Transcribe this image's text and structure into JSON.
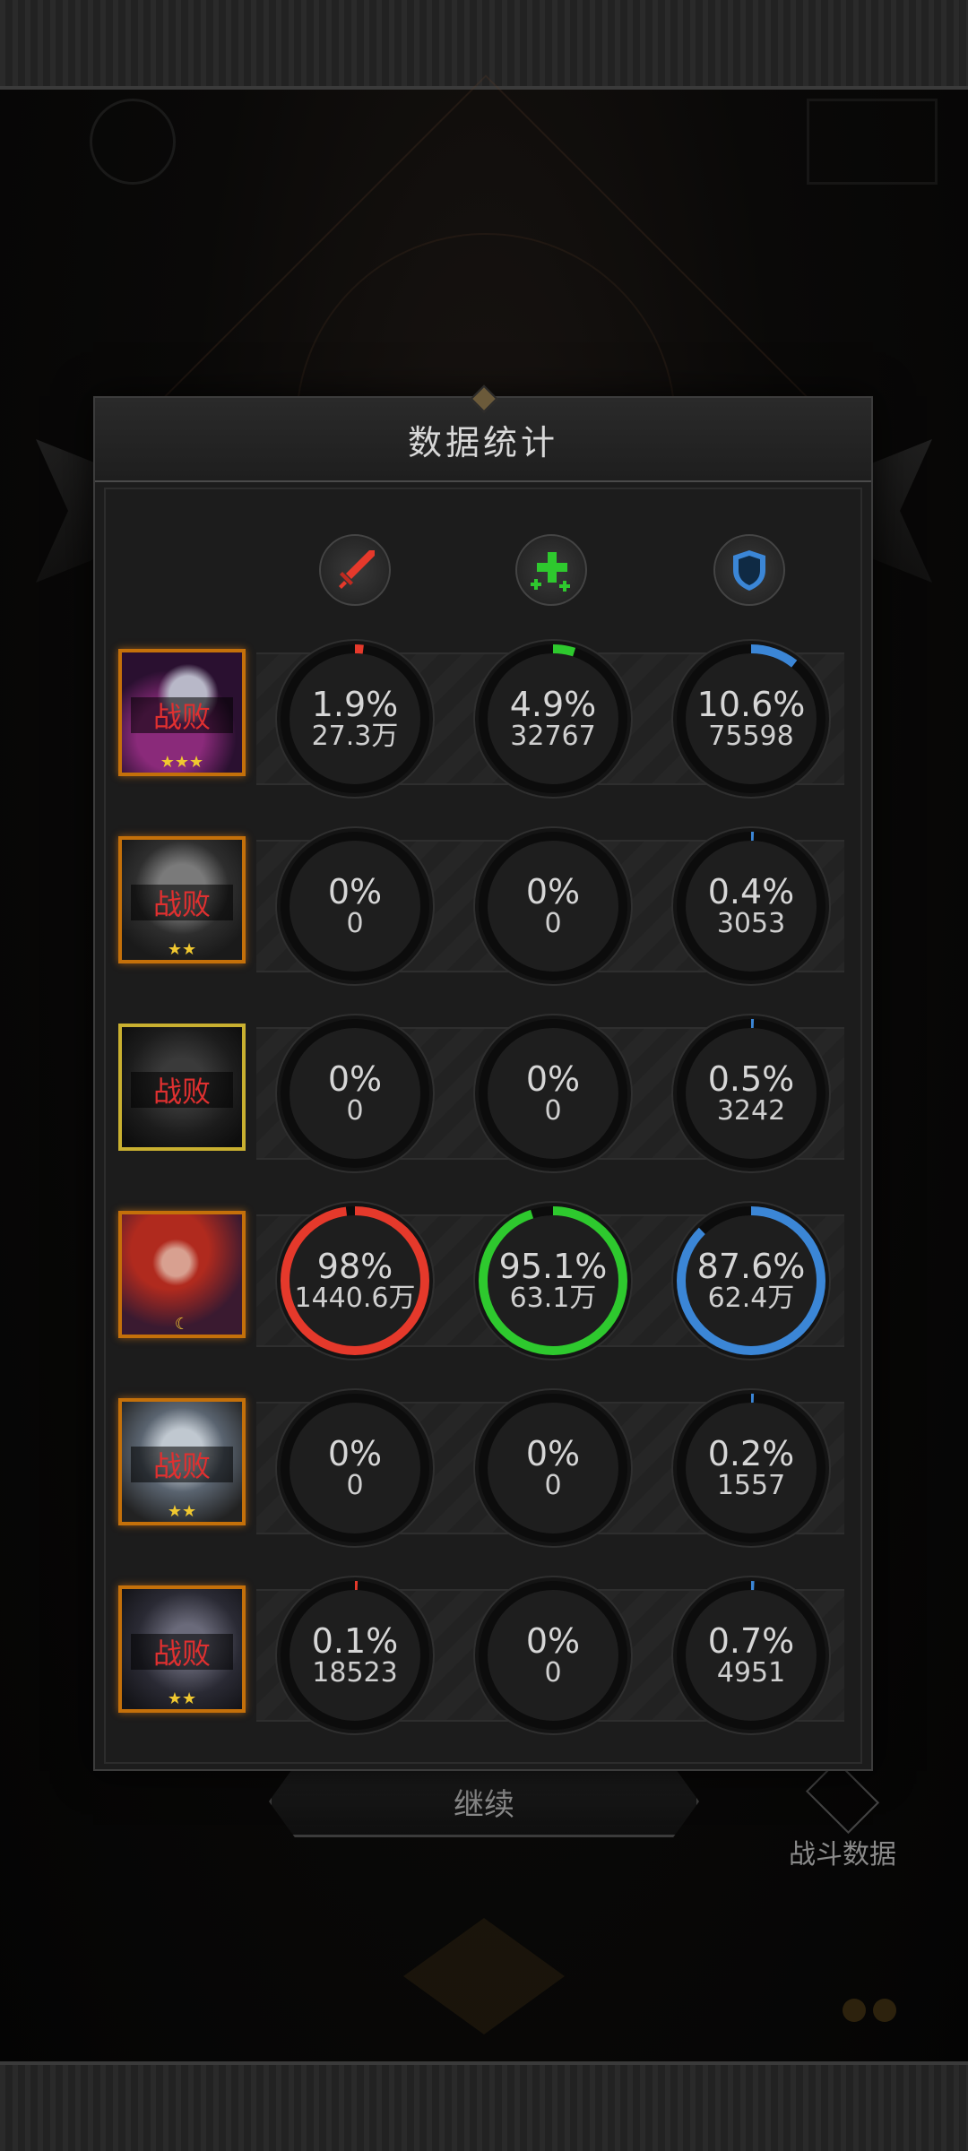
{
  "panel": {
    "title": "数据统计"
  },
  "columns": [
    {
      "icon": "sword-icon",
      "color": "#e5392b"
    },
    {
      "icon": "heal-plus-icon",
      "color": "#2ec92e"
    },
    {
      "icon": "shield-icon",
      "color": "#3b86d6"
    }
  ],
  "heroes": [
    {
      "status": "战败",
      "stars": "★★★",
      "damage": {
        "pct": "1.9%",
        "value": "27.3万",
        "fraction": 0.019
      },
      "healing": {
        "pct": "4.9%",
        "value": "32767",
        "fraction": 0.049
      },
      "tank": {
        "pct": "10.6%",
        "value": "75598",
        "fraction": 0.106
      }
    },
    {
      "status": "战败",
      "stars": "★★",
      "damage": {
        "pct": "0%",
        "value": "0",
        "fraction": 0
      },
      "healing": {
        "pct": "0%",
        "value": "0",
        "fraction": 0
      },
      "tank": {
        "pct": "0.4%",
        "value": "3053",
        "fraction": 0.004
      }
    },
    {
      "status": "战败",
      "stars": "",
      "damage": {
        "pct": "0%",
        "value": "0",
        "fraction": 0
      },
      "healing": {
        "pct": "0%",
        "value": "0",
        "fraction": 0
      },
      "tank": {
        "pct": "0.5%",
        "value": "3242",
        "fraction": 0.005
      }
    },
    {
      "status": "",
      "stars": "☾",
      "damage": {
        "pct": "98%",
        "value": "1440.6万",
        "fraction": 0.98
      },
      "healing": {
        "pct": "95.1%",
        "value": "63.1万",
        "fraction": 0.951
      },
      "tank": {
        "pct": "87.6%",
        "value": "62.4万",
        "fraction": 0.876
      }
    },
    {
      "status": "战败",
      "stars": "★★",
      "damage": {
        "pct": "0%",
        "value": "0",
        "fraction": 0
      },
      "healing": {
        "pct": "0%",
        "value": "0",
        "fraction": 0
      },
      "tank": {
        "pct": "0.2%",
        "value": "1557",
        "fraction": 0.002
      }
    },
    {
      "status": "战败",
      "stars": "★★",
      "damage": {
        "pct": "0.1%",
        "value": "18523",
        "fraction": 0.001
      },
      "healing": {
        "pct": "0%",
        "value": "0",
        "fraction": 0
      },
      "tank": {
        "pct": "0.7%",
        "value": "4951",
        "fraction": 0.007
      }
    }
  ],
  "footer": {
    "continue_label": "继续",
    "battle_data_label": "战斗数据"
  }
}
